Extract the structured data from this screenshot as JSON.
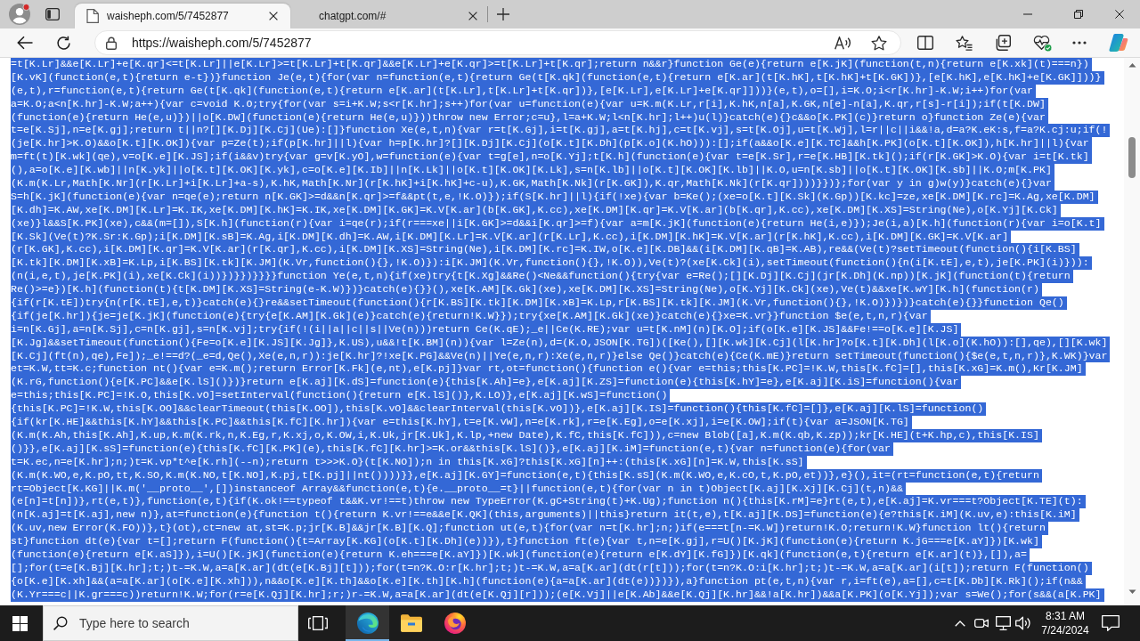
{
  "browser": {
    "tabs": [
      {
        "title": "waisheph.com/5/7452877",
        "selected": true,
        "kind": "document"
      },
      {
        "title": "chatgpt.com/#",
        "selected": false,
        "kind": "blank"
      }
    ],
    "address": "https://waisheph.com/5/7452877"
  },
  "page": {
    "text_selected": true,
    "lines": [
      "=t[K.Lr]&&e[K.Lr]+e[K.qr]<=t[K.Lr]||e[K.Lr]>=t[K.Lr]+t[K.qr]&&e[K.Lr]+e[K.qr]>=t[K.Lr]+t[K.qr];return n&&r}function Ge(e){return e[K.jK](function(t,n){return e[K.xk](t)===n})",
      "[K.vK](function(e,t){return e-t})}function Je(e,t){for(var n=function(e,t){return Ge(t[K.qk](function(e,t){return e[K.ar](t[K.hK],t[K.hK]+t[K.GK])},[e[K.hK],e[K.hK]+e[K.GK]]))}",
      "(e,t),r=function(e,t){return Ge(t[K.qk](function(e,t){return e[K.ar](t[K.Lr],t[K.Lr]+t[K.qr])},[e[K.Lr],e[K.Lr]+e[K.qr]]))}(e,t),o=[],i=K.O;i<r[K.hr]-K.W;i++)for(var",
      "a=K.O;a<n[K.hr]-K.W;a++){var c=void K.O;try{for(var s=i+K.W;s<r[K.hr];s++)for(var u=function(e){var u=K.m(K.Lr,r[i],K.hK,n[a],K.GK,n[e]-n[a],K.qr,r[s]-r[i]);if(t[K.DW]",
      "(function(e){return He(e,u)})||o[K.DW](function(e){return He(e,u)}))throw new Error;c=u},l=a+K.W;l<n[K.hr];l++)u(l)}catch(e){}c&&o[K.PK](c)}return o}function Ze(e){var",
      "t=e[K.Sj],n=e[K.gj];return t||n?[][K.Dj][K.Cj](Ue):[]}function Xe(e,t,n){var r=t[K.Gj],i=t[K.gj],a=t[K.hj],c=t[K.vj],s=t[K.Oj],u=t[K.Wj],l=r||c||i&&!a,d=a?K.eK:s,f=a?K.cj:u;if(!",
      "(je[K.hr]>K.O)&&o[K.t][K.OK]){var p=Ze(t);if(p[K.hr]||l){var h=p[K.hr]?[][K.Dj][K.Cj](o[K.t][K.Dh](p[K.o](K.hO))):[];if(a&&o[K.e][K.TC]&&h[K.PK](o[K.t][K.OK]),h[K.hr]||l){var",
      "m=ft(t)[K.wk](qe),v=o[K.e][K.JS];if(i&&v)try{var g=v[K.yO],w=function(e){var t=g[e],n=o[K.Yj];t[K.h](function(e){var t=e[K.Sr],r=e[K.HB][K.tk]();if(r[K.GK]>K.O){var i=t[K.tk]",
      "(),a=o[K.e][K.wb]||n[K.yk]||o[K.t][K.OK][K.yk],c=o[K.e][K.Ib]||n[K.Lk]||o[K.t][K.OK][K.Lk],s=n[K.lb]||o[K.t][K.OK][K.lb]||K.O,u=n[K.sb]||o[K.t][K.OK][K.sb]||K.O;m[K.PK]",
      "(K.m(K.Lr,Math[K.Nr](r[K.Lr]+i[K.Lr]+a-s),K.hK,Math[K.Nr](r[K.hK]+i[K.hK]+c-u),K.GK,Math[K.Nk](r[K.GK]),K.qr,Math[K.Nk](r[K.qr])))}})};for(var y in g)w(y)}catch(e){}var",
      "S=h[K.jK](function(e){var n=qe(e);return n[K.GK]>=d&&n[K.qr]>=f&&pt(t,e,!K.O)});if(S[K.hr]||l){if(!xe){var b=Ke();(xe=o[K.t][K.Sk](K.Gp))[K.kc]=ze,xe[K.DM][K.rc]=K.Ag,xe[K.DM]",
      "[K.dh]=K.AW,xe[K.DM][K.Lr]=K.IK,xe[K.DM][K.hK]=K.IK,xe[K.DM][K.GK]=K.V[K.ar](b[K.GK],K.cc),xe[K.DM][K.qr]=K.V[K.ar](b[K.qr],K.cc),xe[K.DM][K.XS]=String(Ne),o[K.Yj][K.Ck]",
      "(xe)}l&&S[K.PK](xe),c&&(m=[]),S[K.h](function(r){var i=qe(r);if(r===xe||i[K.GK]>=d&&i[K.qr]>=f){var a=m[K.jK](function(e){return He(i,e)});Je(i,a)[K.h](function(r){var i=o[K.t]",
      "[K.Sk](Ve(t)?K.Sr:K.Gp);i[K.DM][K.sB]=K.Ag,i[K.DM][K.dh]=K.AW,i[K.DM][K.Lr]=K.V[K.ar](r[K.Lr],K.cc),i[K.DM][K.hK]=K.V[K.ar](r[K.hK],K.cc),i[K.DM][K.GK]=K.V[K.ar]",
      "(r[K.GK],K.cc),i[K.DM][K.qr]=K.V[K.ar](r[K.qr],K.cc),i[K.DM][K.XS]=String(Ne),i[K.DM][K.rc]=K.IW,o[K.e][K.DB]&&(i[K.DM][K.qB]=K.AB),re&&(Ve(t)?setTimeout(function(){i[K.BS]",
      "[K.tk][K.DM][K.xB]=K.Lp,i[K.BS][K.tk][K.JM](K.Vr,function(){},!K.O)}):i[K.JM](K.Vr,function(){},!K.O)),Ve(t)?(xe[K.Ck](i),setTimeout(function(){n(i[K.tE],e,t),je[K.PK](i)})):",
      "(n(i,e,t),je[K.PK](i),xe[K.Ck](i))})}})}}}}function Ye(e,t,n){if(xe)try{t[K.Xg]&&Re()<Ne&&function(){try{var e=Re();[][K.Dj][K.Cj](jr[K.Dh](K.np))[K.jK](function(t){return",
      "Re()>=e})[K.h](function(t){t[K.DM][K.XS]=String(e-K.W)})}catch(e){}}(),xe[K.AM][K.Gk](xe),xe[K.DM][K.XS]=String(Ne),o[K.Yj][K.Ck](xe),Ve(t)&&xe[K.wY][K.h](function(r)",
      "{if(r[K.tE])try{n(r[K.tE],e,t)}catch(e){}re&&setTimeout(function(){r[K.BS][K.tk][K.DM][K.xB]=K.Lp,r[K.BS][K.tk][K.JM](K.Vr,function(){},!K.O)})})}catch(e){}}function Qe()",
      "{if(je[K.hr]){je=je[K.jK](function(e){try{e[K.AM][K.Gk](e)}catch(e){return!K.W}});try{xe[K.AM][K.Gk](xe)}catch(e){}xe=K.vr}}function $e(e,t,n,r){var",
      "i=n[K.Gj],a=n[K.Sj],c=n[K.gj],s=n[K.vj];try{if(!(i||a||c||s||Ve(n)))return Ce(K.qE);_e||Ce(K.RE);var u=t[K.nM](n)[K.O];if(o[K.e][K.JS]&&Fe!==o[K.e][K.JS]",
      "[K.Jg]&&setTimeout(function(){Fe=o[K.e][K.JS][K.Jg]},K.US),u&&!t[K.BM](n)){var l=Ze(n),d=(K.O,JSON[K.TG])([Ke(),[][K.wk][K.Cj](l[K.hr]?o[K.t][K.Dh](l[K.o](K.hO)):[],qe),[][K.wk]",
      "[K.Cj](ft(n),qe),Fe]);_e!==d?(_e=d,Qe(),Xe(e,n,r)):je[K.hr]?!xe[K.PG]&&Ve(n)||Ye(e,n,r):Xe(e,n,r)}else Qe()}catch(e){Ce(K.mE)}return setTimeout(function(){$e(e,t,n,r)},K.WK)}var",
      "et=K.W,tt=K.c;function nt(){var e=K.m();return Error[K.Fk](e,nt),e[K.pj]}var rt,ot=function(){function e(){var e=this;this[K.PC]=!K.W,this[K.fC]=[],this[K.xG]=K.m(),Kr[K.JM]",
      "(K.rG,function(){e[K.PC]&&e[K.lS]()})}return e[K.aj][K.dS]=function(e){this[K.Ah]=e},e[K.aj][K.ZS]=function(e){this[K.hY]=e},e[K.aj][K.iS]=function(){var",
      "e=this;this[K.PC]=!K.O,this[K.vO]=setInterval(function(){return e[K.lS]()},K.LO)},e[K.aj][K.wS]=function()",
      "{this[K.PC]=!K.W,this[K.OO]&&clearTimeout(this[K.OO]),this[K.vO]&&clearInterval(this[K.vO])},e[K.aj][K.IS]=function(){this[K.fC]=[]},e[K.aj][K.lS]=function()",
      "{if(kr[K.HE]&&this[K.hY]&&this[K.PC]&&this[K.fC][K.hr]){var e=this[K.hY],t=e[K.vW],n=e[K.rk],r=e[K.Eg],o=e[K.xj],i=e[K.OW];if(t){var a=JSON[K.TG]",
      "(K.m(K.Ah,this[K.Ah],K.up,K.m(K.rk,n,K.Eg,r,K.xj,o,K.OW,i,K.Uk,jr[K.Uk],K.lp,+new Date),K.fC,this[K.fC])),c=new Blob([a],K.m(K.qb,K.zp));kr[K.HE](t+K.hp,c),this[K.IS]",
      "()}},e[K.aj][K.sS]=function(e){this[K.fC][K.PK](e),this[K.fC][K.hr]>=K.or&&this[K.lS]()},e[K.aj][K.iM]=function(e,t){var n=function(e){for(var",
      "t=K.ec,n=e[K.hr];n;)t=K.vp*t^e[K.rh](--n);return t>>>K.O}(t[K.NO]);n in this[K.xG]?this[K.xG][n]++:(this[K.xG][n]=K.W,this[K.sS]",
      "(K.m(K.WO,e,K.pO,tt,K.SO,K.m(K.NO,t[K.NO],K.pj,t[K.pj]||nt())))}},e[K.aj][K.GY]=function(e,t){this[K.sS](K.m(K.WO,e,K.cO,t,K.pO,et))},e}(),it=(rt=function(e,t){return",
      "rt=Object[K.KG]||K.m('__proto__',[])instanceof Array&&function(e,t){e.__proto__=t}||function(e,t){for(var n in t)Object[K.aj][K.Xj][K.Cj](t,n)&&",
      "(e[n]=t[n])},rt(e,t)},function(e,t){if(K.ok!==typeof t&&K.vr!==t)throw new TypeError(K.gC+String(t)+K.Ug);function n(){this[K.rM]=e}rt(e,t),e[K.aj]=K.vr===t?Object[K.TE](t):",
      "(n[K.aj]=t[K.aj],new n)},at=function(e){function t(){return K.vr!==e&&e[K.QK](this,arguments)||this}return it(t,e),t[K.aj][K.DS]=function(e){e?this[K.iM](K.uv,e):this[K.iM]",
      "(K.uv,new Error(K.FO))},t}(ot),ct=new at,st=K.p;jr[K.B]&&jr[K.B][K.Q];function ut(e,t){for(var n=t[K.hr];n;)if(e===t[n-=K.W])return!K.O;return!K.W}function lt(){return",
      "st}function dt(e){var t=[];return F(function(){t=Array[K.KG](o[K.t][K.Dh](e))}),t}function ft(e){var t,n=e[K.gj],r=U()[K.jK](function(e){return K.jG===e[K.aY]})[K.wk]",
      "(function(e){return e[K.aS]}),i=U()[K.jK](function(e){return K.eh===e[K.aY]})[K.wk](function(e){return e[K.dY][K.fG]})[K.qk](function(e,t){return e[K.ar](t)},[]),a=",
      "[];for(t=e[K.Bj][K.hr];t;)t-=K.W,a=a[K.ar](dt(e[K.Bj][t]));for(t=n?K.O:r[K.hr];t;)t-=K.W,a=a[K.ar](dt(r[t]));for(t=n?K.O:i[K.hr];t;)t-=K.W,a=a[K.ar](i[t]);return F(function()",
      "{o[K.e][K.xh]&&(a=a[K.ar](o[K.e][K.xh])),n&&o[K.e][K.th]&&o[K.e][K.th][K.h](function(e){a=a[K.ar](dt(e))})}),a}function pt(e,t,n){var r,i=ft(e),a=[],c=t[K.Db][K.Rk]();if(n&&",
      "(K.Yr===c||K.gr===c))return!K.W;for(r=e[K.Qj][K.hr];r;)r-=K.W,a=a[K.ar](dt(e[K.Qj][r]));(e[K.Vj]||e[K.Ab]&&e[K.Qj][K.hr]&&!a[K.hr])&&a[K.PK](o[K.Yj]);var s=We();for(s&&(a[K.PK]"
    ]
  },
  "taskbar": {
    "search": {
      "placeholder": "Type here to search"
    },
    "apps": [
      {
        "kind": "edge",
        "active": true
      },
      {
        "kind": "explorer",
        "active": false
      },
      {
        "kind": "firefox",
        "active": false
      }
    ],
    "time": "8:31 AM",
    "date": "7/24/2024"
  }
}
